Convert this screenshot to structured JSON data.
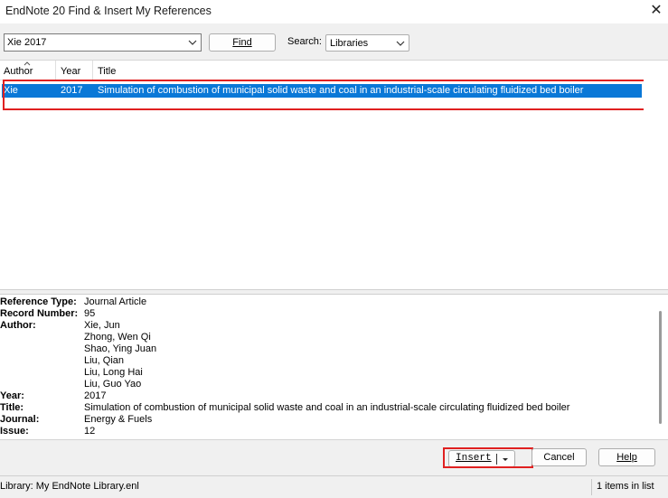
{
  "window": {
    "title": "EndNote 20 Find & Insert My References"
  },
  "toolbar": {
    "query_value": "Xie 2017",
    "find_label": "Find",
    "search_label": "Search:",
    "search_scope": "Libraries"
  },
  "list": {
    "columns": [
      "Author",
      "Year",
      "Title"
    ],
    "rows": [
      {
        "author": "Xie",
        "year": "2017",
        "title": "Simulation of combustion of municipal solid waste and coal in an industrial-scale circulating fluidized bed boiler"
      }
    ]
  },
  "detail": {
    "reference_type_label": "Reference Type:",
    "reference_type": "Journal Article",
    "record_number_label": "Record Number:",
    "record_number": "95",
    "author_label": "Author:",
    "authors": [
      "Xie, Jun",
      "Zhong, Wen Qi",
      "Shao, Ying Juan",
      "Liu, Qian",
      "Liu, Long Hai",
      "Liu, Guo Yao"
    ],
    "year_label": "Year:",
    "year": "2017",
    "title_label": "Title:",
    "title": "Simulation of combustion of municipal solid waste and coal in an industrial-scale circulating fluidized bed boiler",
    "journal_label": "Journal:",
    "journal": "Energy & Fuels",
    "issue_label": "Issue:",
    "issue": "12"
  },
  "actions": {
    "insert_label": "Insert",
    "cancel_label": "Cancel",
    "help_label": "Help"
  },
  "status": {
    "library": "Library: My EndNote Library.enl",
    "count": "1 items in list"
  },
  "colors": {
    "selection": "#0a78d7",
    "highlight_outline": "#e02020"
  }
}
